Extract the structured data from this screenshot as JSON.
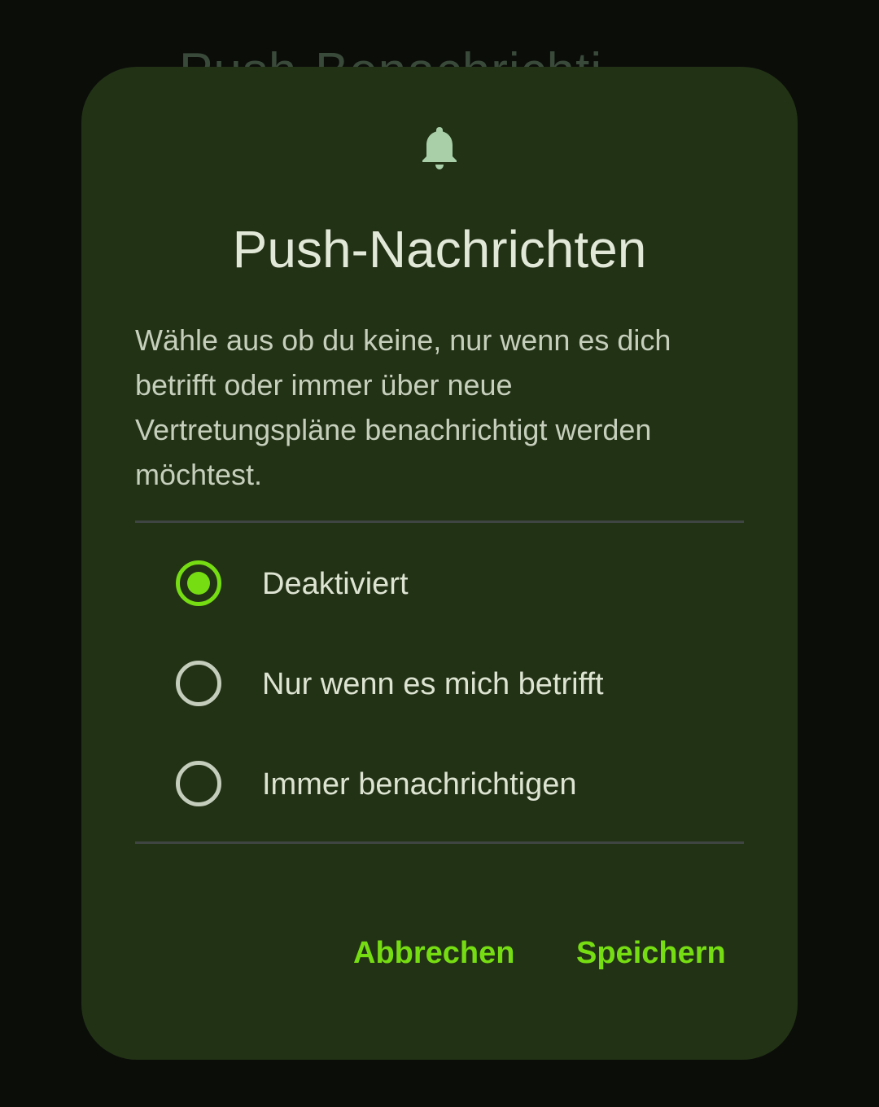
{
  "background": {
    "partial_title": "Push-Benachrichti..."
  },
  "dialog": {
    "icon": "bell-icon",
    "title": "Push-Nachrichten",
    "description": "Wähle aus ob du keine, nur wenn es dich betrifft oder immer über neue Vertretungspläne benachrichtigt werden möchtest.",
    "options": [
      {
        "label": "Deaktiviert",
        "selected": true
      },
      {
        "label": "Nur wenn es mich betrifft",
        "selected": false
      },
      {
        "label": "Immer benachrichtigen",
        "selected": false
      }
    ],
    "cancel_label": "Abbrechen",
    "save_label": "Speichern"
  },
  "colors": {
    "accent": "#76dd13",
    "dialog_background": "#223215",
    "screen_background": "#0b0d09",
    "icon_tint": "#a9cfa9"
  }
}
